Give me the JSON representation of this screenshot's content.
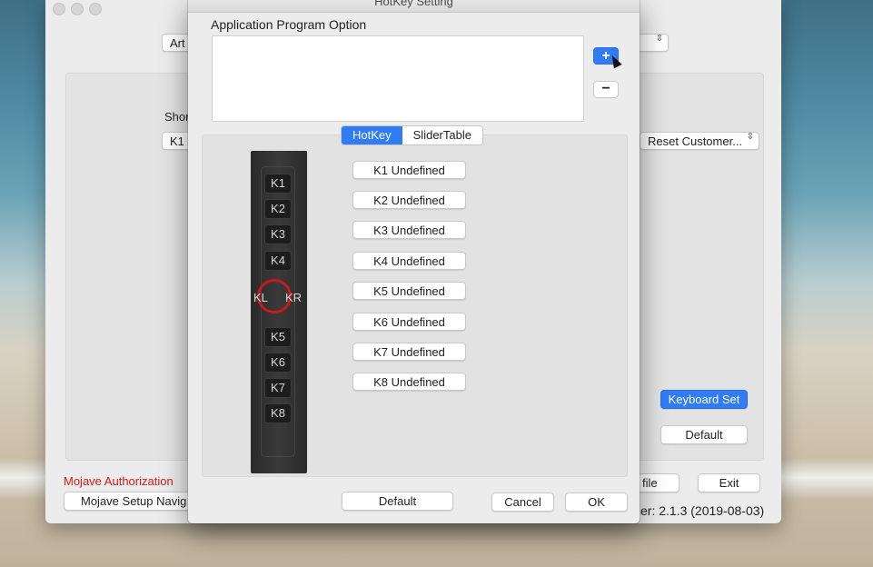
{
  "background_window": {
    "top_popup_left": "Art",
    "top_popup_right": "",
    "shortcut_label": "Shor",
    "key_popup": "K1",
    "reset_popup": "Reset Customer...",
    "keyboard_set_button": "Keyboard Set",
    "default_button": "Default",
    "profile_button": "file",
    "exit_button": "Exit",
    "mojave_authorization_link": "Mojave Authorization",
    "mojave_setup_button": "Mojave Setup Navig",
    "version_text": "er: 2.1.3 (2019-08-03)"
  },
  "dialog": {
    "title": "HotKey Setting",
    "app_program_label": "Application Program Option",
    "add_label": "+",
    "remove_label": "−",
    "tabs": [
      "HotKey",
      "SliderTable"
    ],
    "active_tab": "HotKey",
    "device_keys_top": [
      "K1",
      "K2",
      "K3",
      "K4"
    ],
    "device_keys_bottom": [
      "K5",
      "K6",
      "K7",
      "K8"
    ],
    "dial_left": "KL",
    "dial_right": "KR",
    "hotkey_buttons": [
      "K1 Undefined",
      "K2 Undefined",
      "K3 Undefined",
      "K4 Undefined",
      "K5 Undefined",
      "K6 Undefined",
      "K7 Undefined",
      "K8 Undefined"
    ],
    "default_button": "Default",
    "cancel_button": "Cancel",
    "ok_button": "OK"
  },
  "colors": {
    "accent_blue": "#2f7cf6",
    "link_red": "#d21a1a",
    "dial_ring": "#c81a1a"
  }
}
